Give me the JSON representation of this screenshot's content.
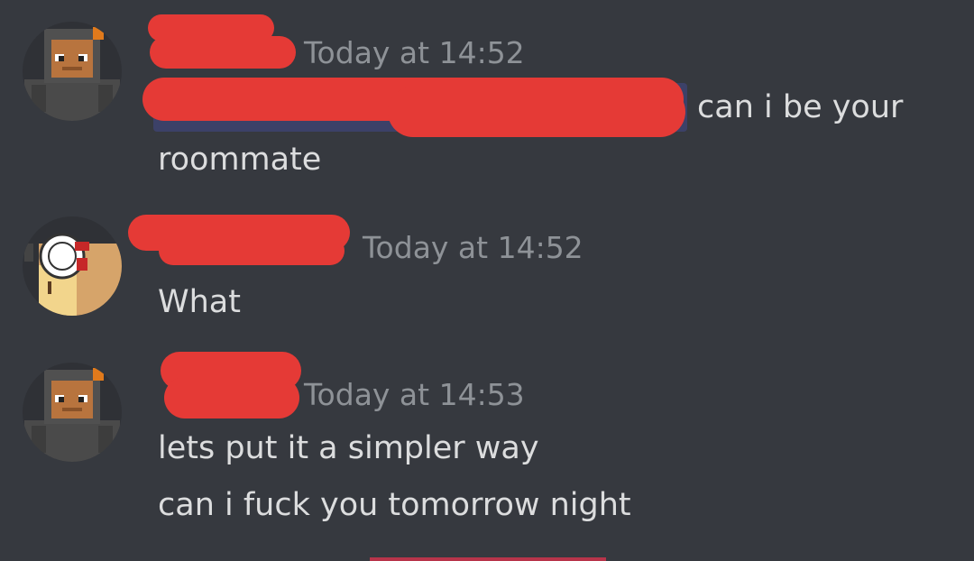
{
  "messages": [
    {
      "timestamp": "Today at 14:52",
      "lines": [
        "can i be your",
        "roommate"
      ],
      "avatar_icon": "minecraft-skin-avatar-icon"
    },
    {
      "timestamp": "Today at 14:52",
      "lines": [
        "What"
      ],
      "avatar_icon": "masked-character-avatar-icon"
    },
    {
      "timestamp": "Today at 14:53",
      "lines": [
        "lets put it a simpler way",
        "can i fuck you tomorrow night"
      ],
      "avatar_icon": "minecraft-skin-avatar-icon"
    }
  ],
  "colors": {
    "background": "#36393f",
    "text": "#dcddde",
    "timestamp": "#8e9297",
    "redaction": "#e53a36",
    "mention": "#3c4168",
    "new_messages_divider": "#b8344a"
  }
}
